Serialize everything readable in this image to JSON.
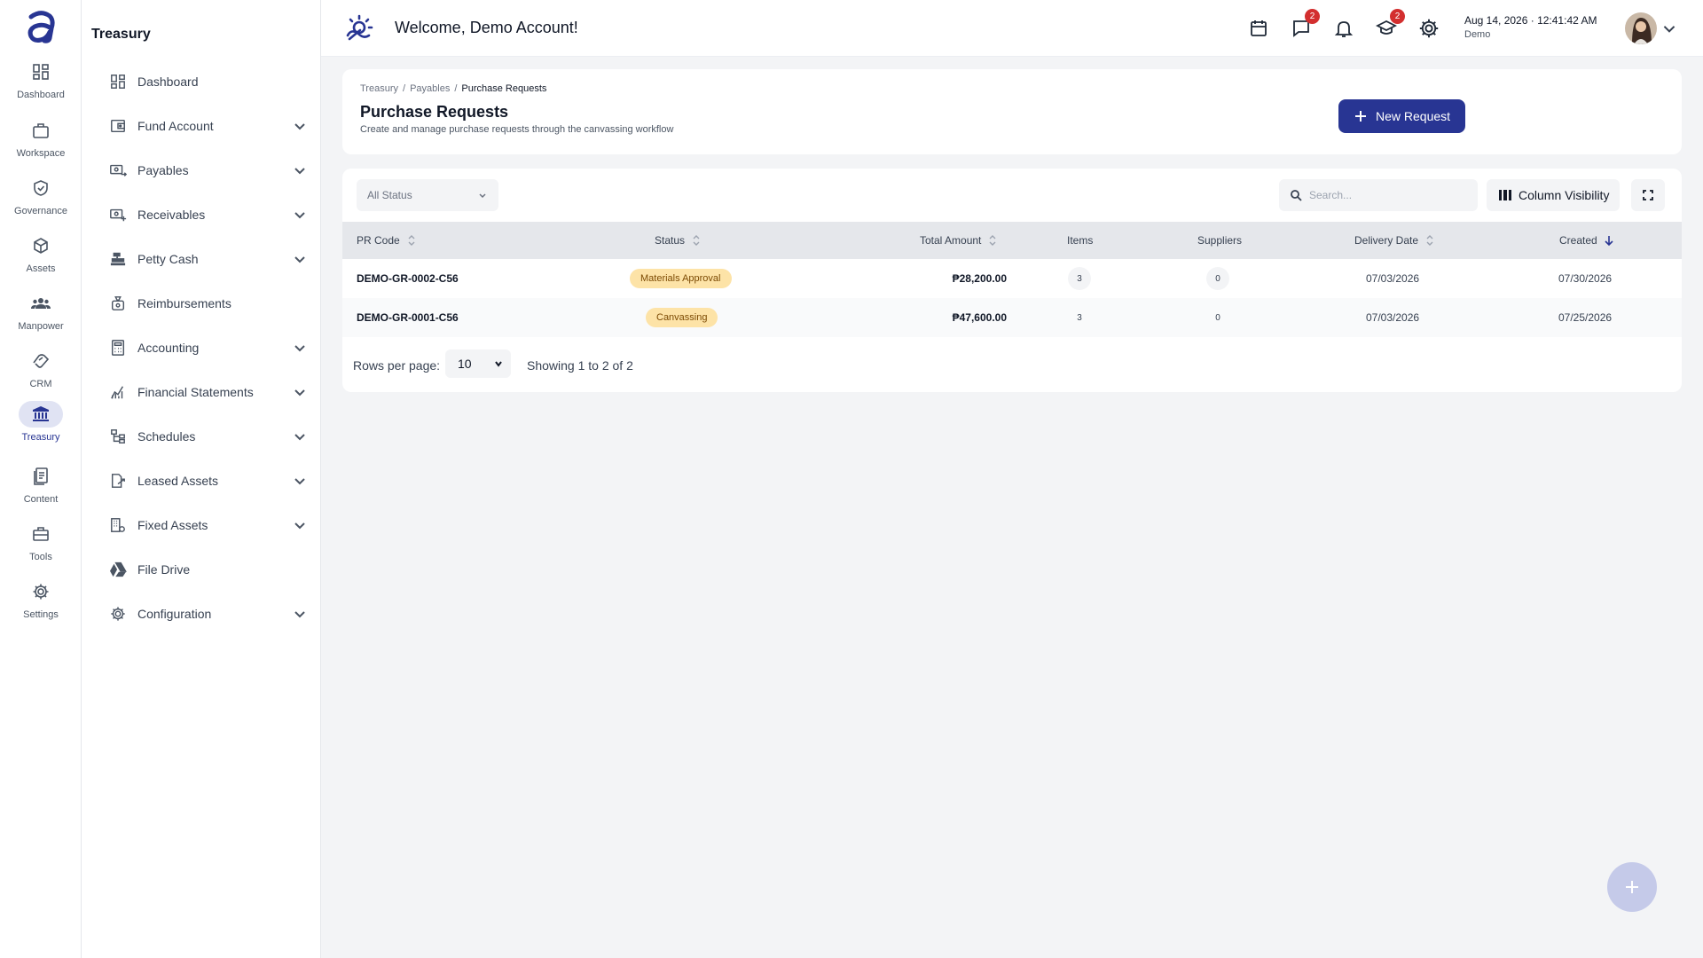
{
  "rail": {
    "items": [
      {
        "label": "Dashboard",
        "icon": "dashboard-icon"
      },
      {
        "label": "Workspace",
        "icon": "briefcase-icon"
      },
      {
        "label": "Governance",
        "icon": "shield-check-icon"
      },
      {
        "label": "Assets",
        "icon": "cube-icon"
      },
      {
        "label": "Manpower",
        "icon": "people-icon"
      },
      {
        "label": "CRM",
        "icon": "handshake-icon"
      },
      {
        "label": "Treasury",
        "icon": "bank-icon",
        "active": true
      },
      {
        "label": "Content",
        "icon": "document-icon"
      },
      {
        "label": "Tools",
        "icon": "toolbox-icon"
      },
      {
        "label": "Settings",
        "icon": "gear-icon"
      }
    ]
  },
  "sidebar": {
    "title": "Treasury",
    "items": [
      {
        "label": "Dashboard",
        "icon": "dashboard-icon",
        "expandable": false
      },
      {
        "label": "Fund Account",
        "icon": "wallet-icon",
        "expandable": true
      },
      {
        "label": "Payables",
        "icon": "cash-out-icon",
        "expandable": true
      },
      {
        "label": "Receivables",
        "icon": "cash-in-icon",
        "expandable": true
      },
      {
        "label": "Petty Cash",
        "icon": "cash-register-icon",
        "expandable": true
      },
      {
        "label": "Reimbursements",
        "icon": "money-bag-icon",
        "expandable": false
      },
      {
        "label": "Accounting",
        "icon": "calculator-icon",
        "expandable": true
      },
      {
        "label": "Financial Statements",
        "icon": "chart-icon",
        "expandable": true
      },
      {
        "label": "Schedules",
        "icon": "schedule-tree-icon",
        "expandable": true
      },
      {
        "label": "Leased Assets",
        "icon": "leased-doc-icon",
        "expandable": true
      },
      {
        "label": "Fixed Assets",
        "icon": "building-gear-icon",
        "expandable": true
      },
      {
        "label": "File Drive",
        "icon": "drive-icon",
        "expandable": false
      },
      {
        "label": "Configuration",
        "icon": "gear-icon",
        "expandable": true
      }
    ]
  },
  "header": {
    "welcome": "Welcome, Demo Account!",
    "messages_badge": "2",
    "training_badge": "2",
    "date": "Aug 14, 2026",
    "time": "12:41:42 AM",
    "user": "Demo"
  },
  "page": {
    "breadcrumb": [
      "Treasury",
      "Payables",
      "Purchase Requests"
    ],
    "title": "Purchase Requests",
    "subtitle": "Create and manage purchase requests through the canvassing workflow",
    "new_button": "New Request"
  },
  "toolbar": {
    "status_filter": "All Status",
    "search_placeholder": "Search...",
    "column_visibility": "Column Visibility"
  },
  "table": {
    "columns": [
      "PR Code",
      "Status",
      "Total Amount",
      "Items",
      "Suppliers",
      "Delivery Date",
      "Created"
    ],
    "rows": [
      {
        "code": "DEMO-GR-0002-C56",
        "status": "Materials Approval",
        "amount": "₱28,200.00",
        "items": "3",
        "suppliers": "0",
        "delivery": "07/03/2026",
        "created": "07/30/2026"
      },
      {
        "code": "DEMO-GR-0001-C56",
        "status": "Canvassing",
        "amount": "₱47,600.00",
        "items": "3",
        "suppliers": "0",
        "delivery": "07/03/2026",
        "created": "07/25/2026"
      }
    ]
  },
  "pagination": {
    "rows_label": "Rows per page:",
    "rows_value": "10",
    "showing": "Showing 1 to 2 of 2"
  },
  "colors": {
    "brand": "#283593",
    "status_pill": "#fde3a7",
    "badge": "#d32f2f"
  }
}
